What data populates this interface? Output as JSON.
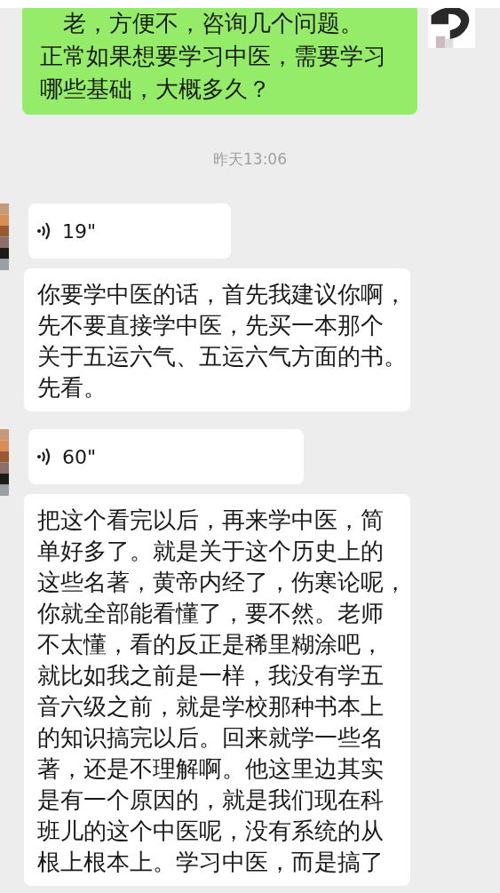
{
  "messages": [
    {
      "kind": "sent_text",
      "avatar": true,
      "lines": [
        "老，方便不，咨询几个问题。",
        "正常如果想要学习中医，需要学习",
        "哪些基础，大概多久？"
      ]
    },
    {
      "kind": "time",
      "text": "昨天13:06"
    },
    {
      "kind": "received_voice",
      "avatar": true,
      "text": "19\""
    },
    {
      "kind": "received_text",
      "avatar": false,
      "lines": [
        "你要学中医的话，首先我建议你啊，",
        "先不要直接学中医，先买一本那个",
        "关于五运六气、五运六气方面的书。",
        "先看。"
      ]
    },
    {
      "kind": "received_voice",
      "avatar": true,
      "text": "60\""
    },
    {
      "kind": "received_text",
      "avatar": false,
      "lines": [
        "把这个看完以后，再来学中医，简",
        "单好多了。就是关于这个历史上的",
        "这些名著，黄帝内经了，伤寒论呢，",
        "你就全部能看懂了，要不然。老师",
        "不太懂，看的反正是稀里糊涂吧，",
        "就比如我之前是一样，我没有学五",
        "音六级之前，就是学校那种书本上",
        "的知识搞完以后。回来就学一些名",
        "著，还是不理解啊。他这里边其实",
        "是有一个原因的，就是我们现在科",
        "班儿的这个中医呢，没有系统的从",
        "根上根本上。学习中医，而是搞了"
      ]
    }
  ]
}
